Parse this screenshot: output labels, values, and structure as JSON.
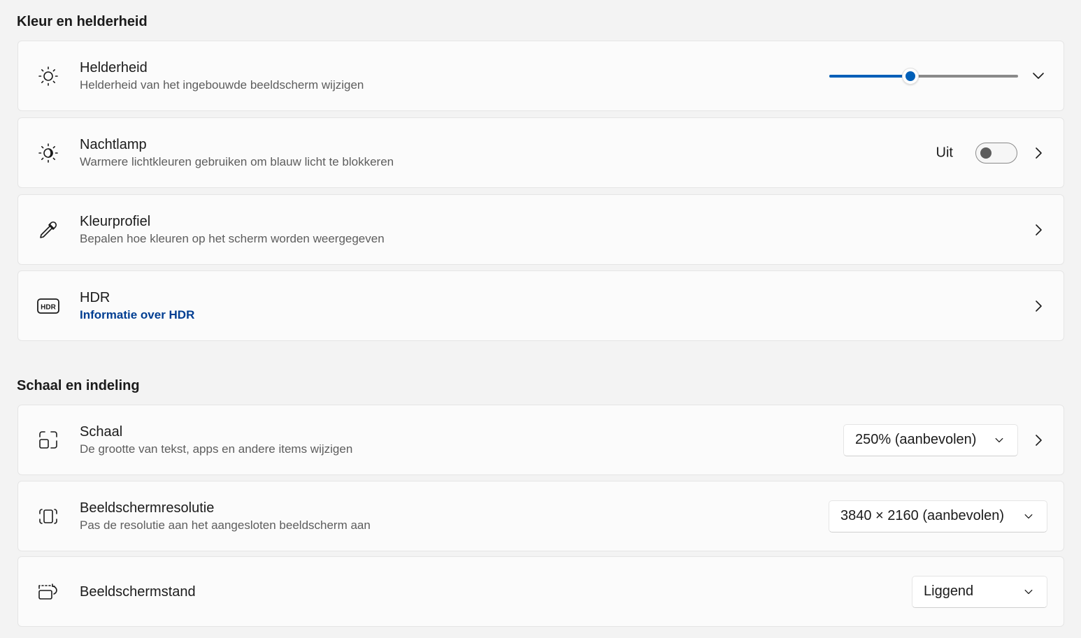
{
  "sections": {
    "color": {
      "title": "Kleur en helderheid"
    },
    "scale": {
      "title": "Schaal en indeling"
    }
  },
  "brightness": {
    "title": "Helderheid",
    "subtitle": "Helderheid van het ingebouwde beeldscherm wijzigen",
    "value_fraction": 0.43,
    "icon": "sun-icon"
  },
  "night_light": {
    "title": "Nachtlamp",
    "subtitle": "Warmere lichtkleuren gebruiken om blauw licht te blokkeren",
    "toggle_label": "Uit",
    "on": false,
    "icon": "night-light-icon"
  },
  "color_profile": {
    "title": "Kleurprofiel",
    "subtitle": "Bepalen hoe kleuren op het scherm worden weergegeven",
    "icon": "eyedropper-icon"
  },
  "hdr": {
    "title": "HDR",
    "link": "Informatie over HDR",
    "icon_text": "HDR",
    "icon": "hdr-icon"
  },
  "scale": {
    "title": "Schaal",
    "subtitle": "De grootte van tekst, apps en andere items wijzigen",
    "value": "250% (aanbevolen)",
    "icon": "scale-icon"
  },
  "resolution": {
    "title": "Beeldschermresolutie",
    "subtitle": "Pas de resolutie aan het aangesloten beeldscherm aan",
    "value": "3840 × 2160 (aanbevolen)",
    "icon": "resolution-icon"
  },
  "orientation": {
    "title": "Beeldschermstand",
    "value": "Liggend",
    "icon": "orientation-icon"
  },
  "colors": {
    "accent": "#005fb8",
    "link": "#003e92",
    "card": "#fbfbfb",
    "background": "#f3f3f3"
  }
}
